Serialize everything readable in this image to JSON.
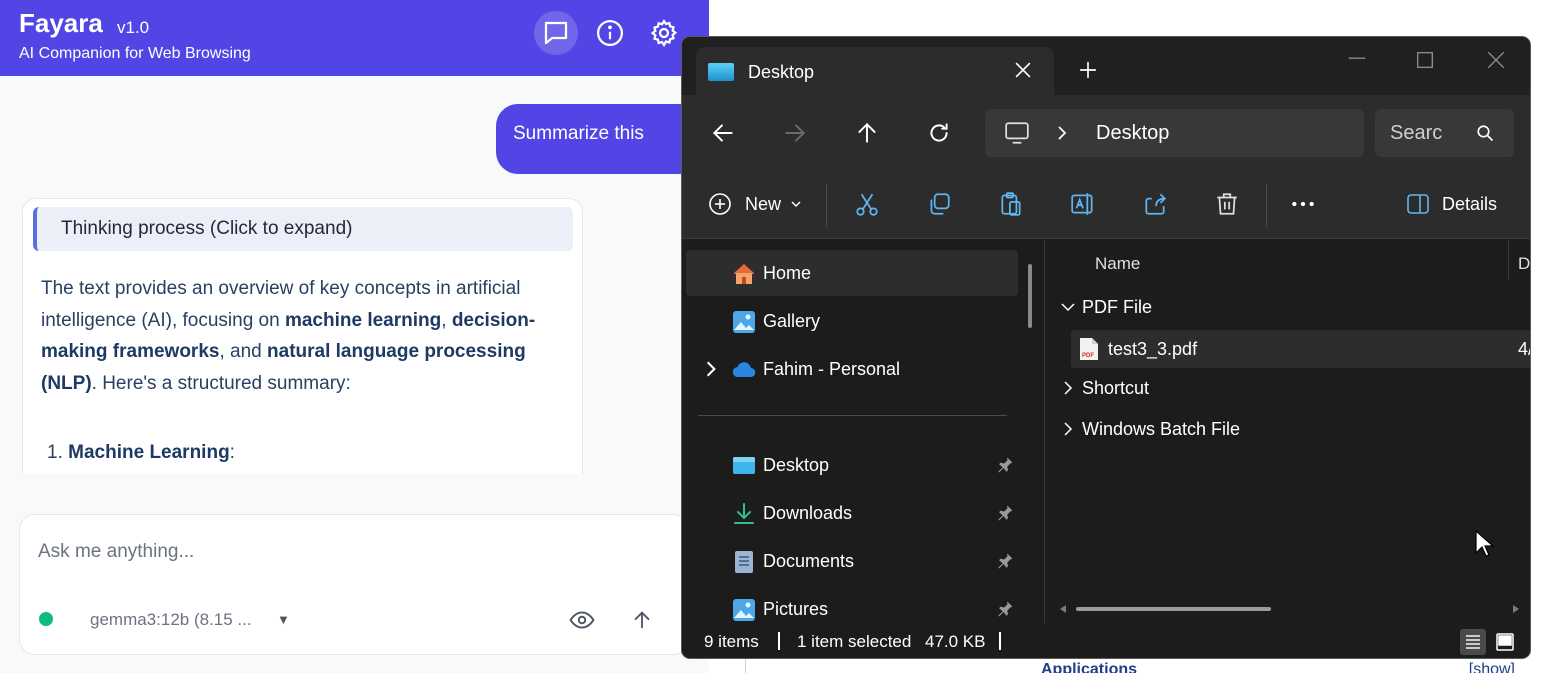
{
  "fayara": {
    "title": "Fayara",
    "version": "v1.0",
    "subtitle": "AI Companion for Web Browsing",
    "header_buttons": [
      "chat-icon",
      "info-icon",
      "gear-icon"
    ],
    "user_message": "Summarize this",
    "thinking_label": "Thinking process (Click to expand)",
    "ai_response": {
      "p1": "The text provides an overview of key concepts in artificial intelligence (AI), focusing on ",
      "b1": "machine learning",
      "p2": ", ",
      "b2": "decision-making frameworks",
      "p3": ", and ",
      "b3": "natural language processing (NLP)",
      "p4": ". Here's a structured summary:",
      "list_num": "1.",
      "list_b1": "Machine Learning",
      "list_colon": ":"
    },
    "input_placeholder": "Ask me anything...",
    "model_label": "gemma3:12b (8.15 ...",
    "accent": "#5145e5",
    "status_color": "#10b981"
  },
  "background_page": {
    "partial_text": "Applications",
    "right_text": "[show]"
  },
  "explorer": {
    "tab_title": "Desktop",
    "address_path": "Desktop",
    "search_placeholder": "Searc",
    "new_label": "New",
    "details_label": "Details",
    "nav": {
      "home": "Home",
      "gallery": "Gallery",
      "onedrive": "Fahim - Personal",
      "desktop": "Desktop",
      "downloads": "Downloads",
      "documents": "Documents",
      "pictures": "Pictures"
    },
    "columns": {
      "name": "Name",
      "date_partial": "D"
    },
    "groups": {
      "pdf": "PDF File",
      "shortcut": "Shortcut",
      "batch": "Windows Batch File"
    },
    "file": {
      "name": "test3_3.pdf",
      "date_partial": "4/"
    },
    "status": {
      "items": "9 items",
      "selected": "1 item selected",
      "size": "47.0 KB"
    }
  }
}
